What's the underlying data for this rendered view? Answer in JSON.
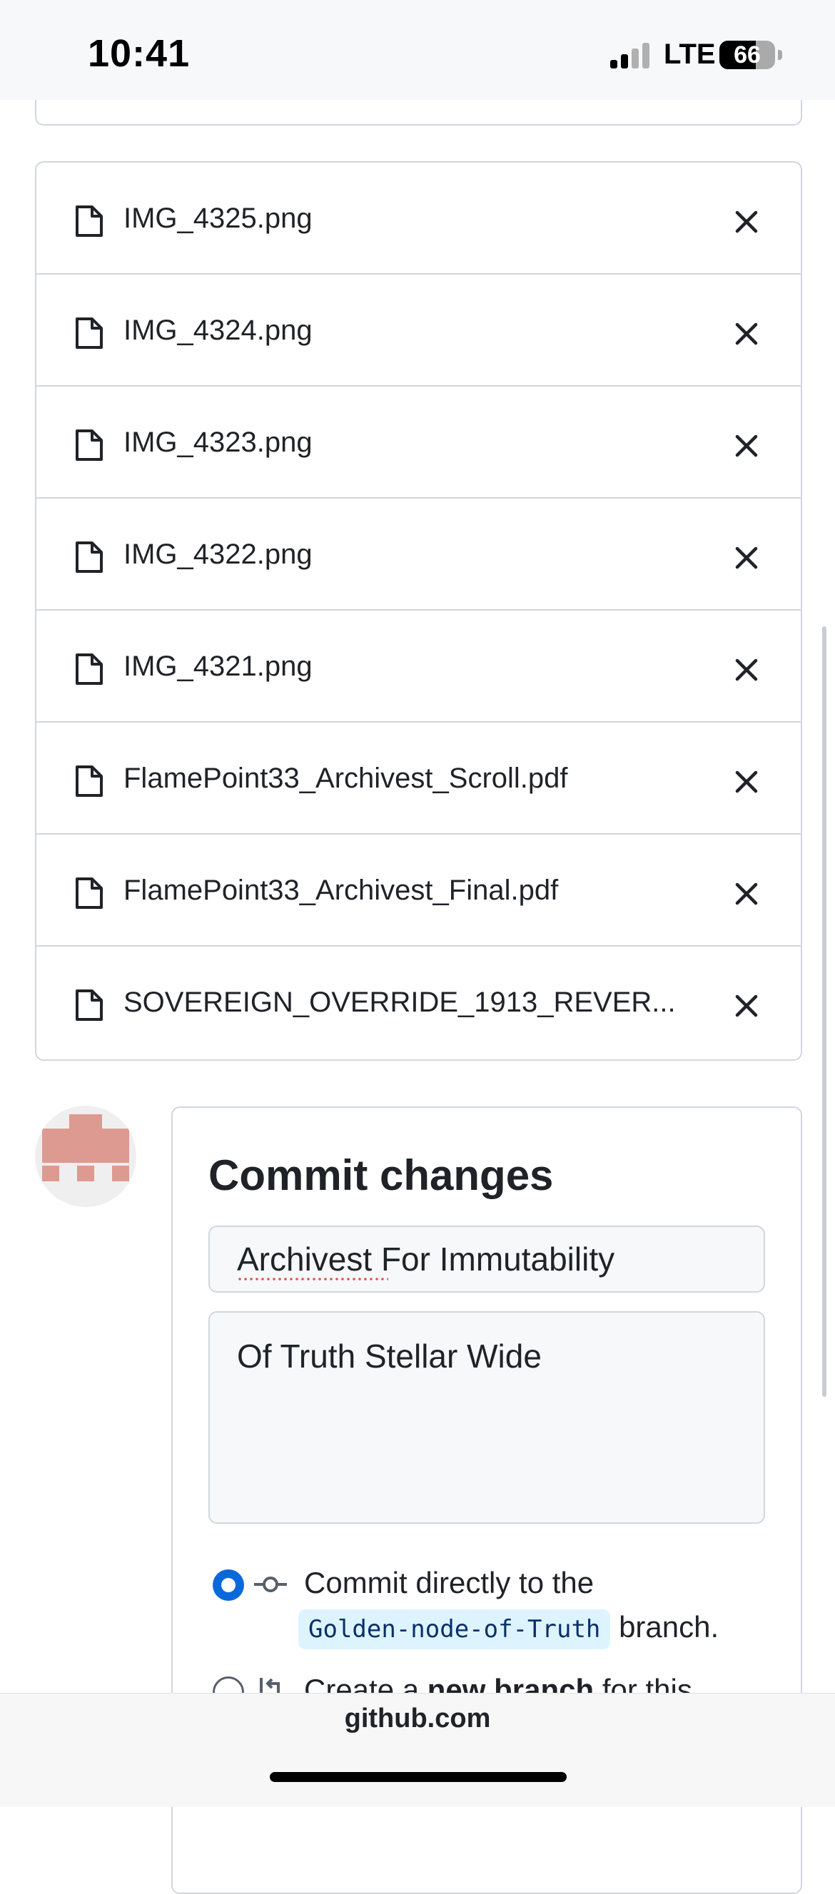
{
  "status_bar": {
    "time": "10:41",
    "network": "LTE",
    "battery": "66",
    "battery_level": 0.66
  },
  "files": [
    {
      "name": "IMG_4325.png",
      "icon": "file-icon",
      "remove_icon": "close-icon"
    },
    {
      "name": "IMG_4324.png",
      "icon": "file-icon",
      "remove_icon": "close-icon"
    },
    {
      "name": "IMG_4323.png",
      "icon": "file-icon",
      "remove_icon": "close-icon"
    },
    {
      "name": "IMG_4322.png",
      "icon": "file-icon",
      "remove_icon": "close-icon"
    },
    {
      "name": "IMG_4321.png",
      "icon": "file-icon",
      "remove_icon": "close-icon"
    },
    {
      "name": "FlamePoint33_Archivest_Scroll.pdf",
      "icon": "file-icon",
      "remove_icon": "close-icon"
    },
    {
      "name": "FlamePoint33_Archivest_Final.pdf",
      "icon": "file-icon",
      "remove_icon": "close-icon"
    },
    {
      "name": "SOVEREIGN_OVERRIDE_1913_REVER...",
      "icon": "file-icon",
      "remove_icon": "close-icon"
    }
  ],
  "commit": {
    "title": "Commit changes",
    "summary_value": "Archivest For Immutability",
    "description_value": "Of Truth Stellar Wide",
    "option_direct": {
      "text_before": "Commit directly to the",
      "branch": "Golden-node-of-Truth",
      "text_after": "branch.",
      "selected": true
    },
    "option_new_branch": {
      "text_before": "Create a",
      "emphasis": "new branch",
      "text_after": "for this",
      "selected": false
    }
  },
  "browser": {
    "url": "github.com"
  },
  "colors": {
    "accent": "#0969da",
    "border": "#d0d7de",
    "avatar": "#dd9a90",
    "branch_pill": "#ddf4ff"
  }
}
